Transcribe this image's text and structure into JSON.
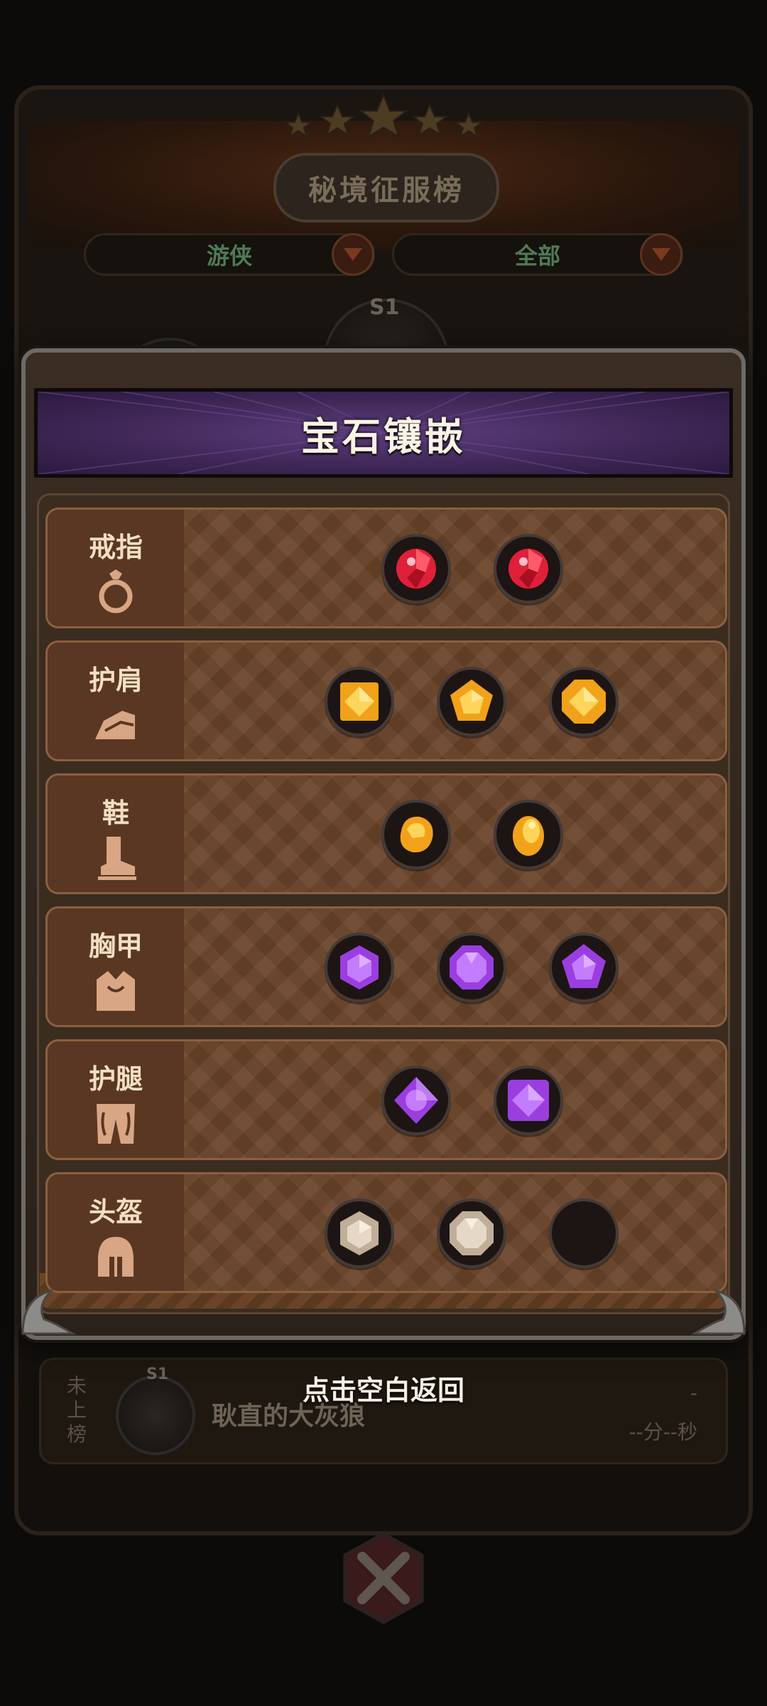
{
  "background": {
    "board_title": "秘境征服榜",
    "filter_class": "游侠",
    "filter_scope": "全部",
    "season_tags": [
      "S1",
      "S1",
      "S1"
    ],
    "my_rank_label": "未上榜",
    "my_name": "耿直的大灰狼",
    "my_time": "--分--秒",
    "my_score": "-"
  },
  "modal": {
    "title": "宝石镶嵌",
    "rows": [
      {
        "label": "戒指",
        "icon": "ring-icon",
        "gems": [
          "red-round",
          "red-round"
        ]
      },
      {
        "label": "护肩",
        "icon": "shoulder-armor-icon",
        "gems": [
          "gold-square",
          "gold-pentagon",
          "gold-octagon"
        ]
      },
      {
        "label": "鞋",
        "icon": "boot-icon",
        "gems": [
          "gold-rough",
          "gold-oval"
        ]
      },
      {
        "label": "胸甲",
        "icon": "chest-armor-icon",
        "gems": [
          "purple-hexagon",
          "purple-octagon",
          "purple-pentagon"
        ]
      },
      {
        "label": "护腿",
        "icon": "leg-armor-icon",
        "gems": [
          "purple-diamond",
          "purple-square"
        ]
      },
      {
        "label": "头盔",
        "icon": "helmet-icon",
        "gems": [
          "beige-hexagon",
          "beige-octagon",
          "empty"
        ]
      }
    ]
  },
  "hint": "点击空白返回",
  "colors": {
    "red_gem": "#e0203a",
    "gold_gem": "#f2a21a",
    "purple_gem": "#9a3ee0",
    "beige_gem": "#d8c8b4",
    "row_bg": "#6a4329",
    "header_purple": "#4a2d66"
  }
}
